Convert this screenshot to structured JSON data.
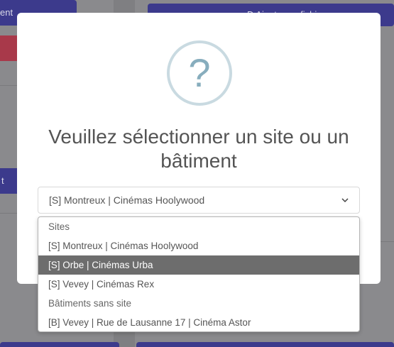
{
  "background": {
    "top_left_button_label": "ent",
    "top_right_button_label": "D  Ajouter un fichier",
    "mid_left_button_label": "t"
  },
  "modal": {
    "icon": "question-mark-icon",
    "title": "Veuillez sélectionner un site ou un bâtiment",
    "select": {
      "selected_value": "[S] Montreux | Cinémas Hoolywood",
      "arrow_icon": "chevron-down-icon"
    }
  },
  "dropdown": {
    "options": [
      {
        "label": "Sites",
        "kind": "group"
      },
      {
        "label": "[S] Montreux | Cinémas Hoolywood",
        "kind": "option"
      },
      {
        "label": "[S] Orbe | Cinémas Urba",
        "kind": "option",
        "highlighted": true
      },
      {
        "label": "[S] Vevey | Cinémas Rex",
        "kind": "option"
      },
      {
        "label": "Bâtiments sans site",
        "kind": "group"
      },
      {
        "label": "[B] Vevey | Rue de Lausanne 17 | Cinéma Astor",
        "kind": "option"
      }
    ]
  },
  "colors": {
    "accent_blue": "#3c3a8c",
    "accent_red": "#a8394a",
    "highlight_gray": "#6d6d6d",
    "icon_ring": "#c9dae1",
    "icon_glyph": "#87adbd"
  }
}
